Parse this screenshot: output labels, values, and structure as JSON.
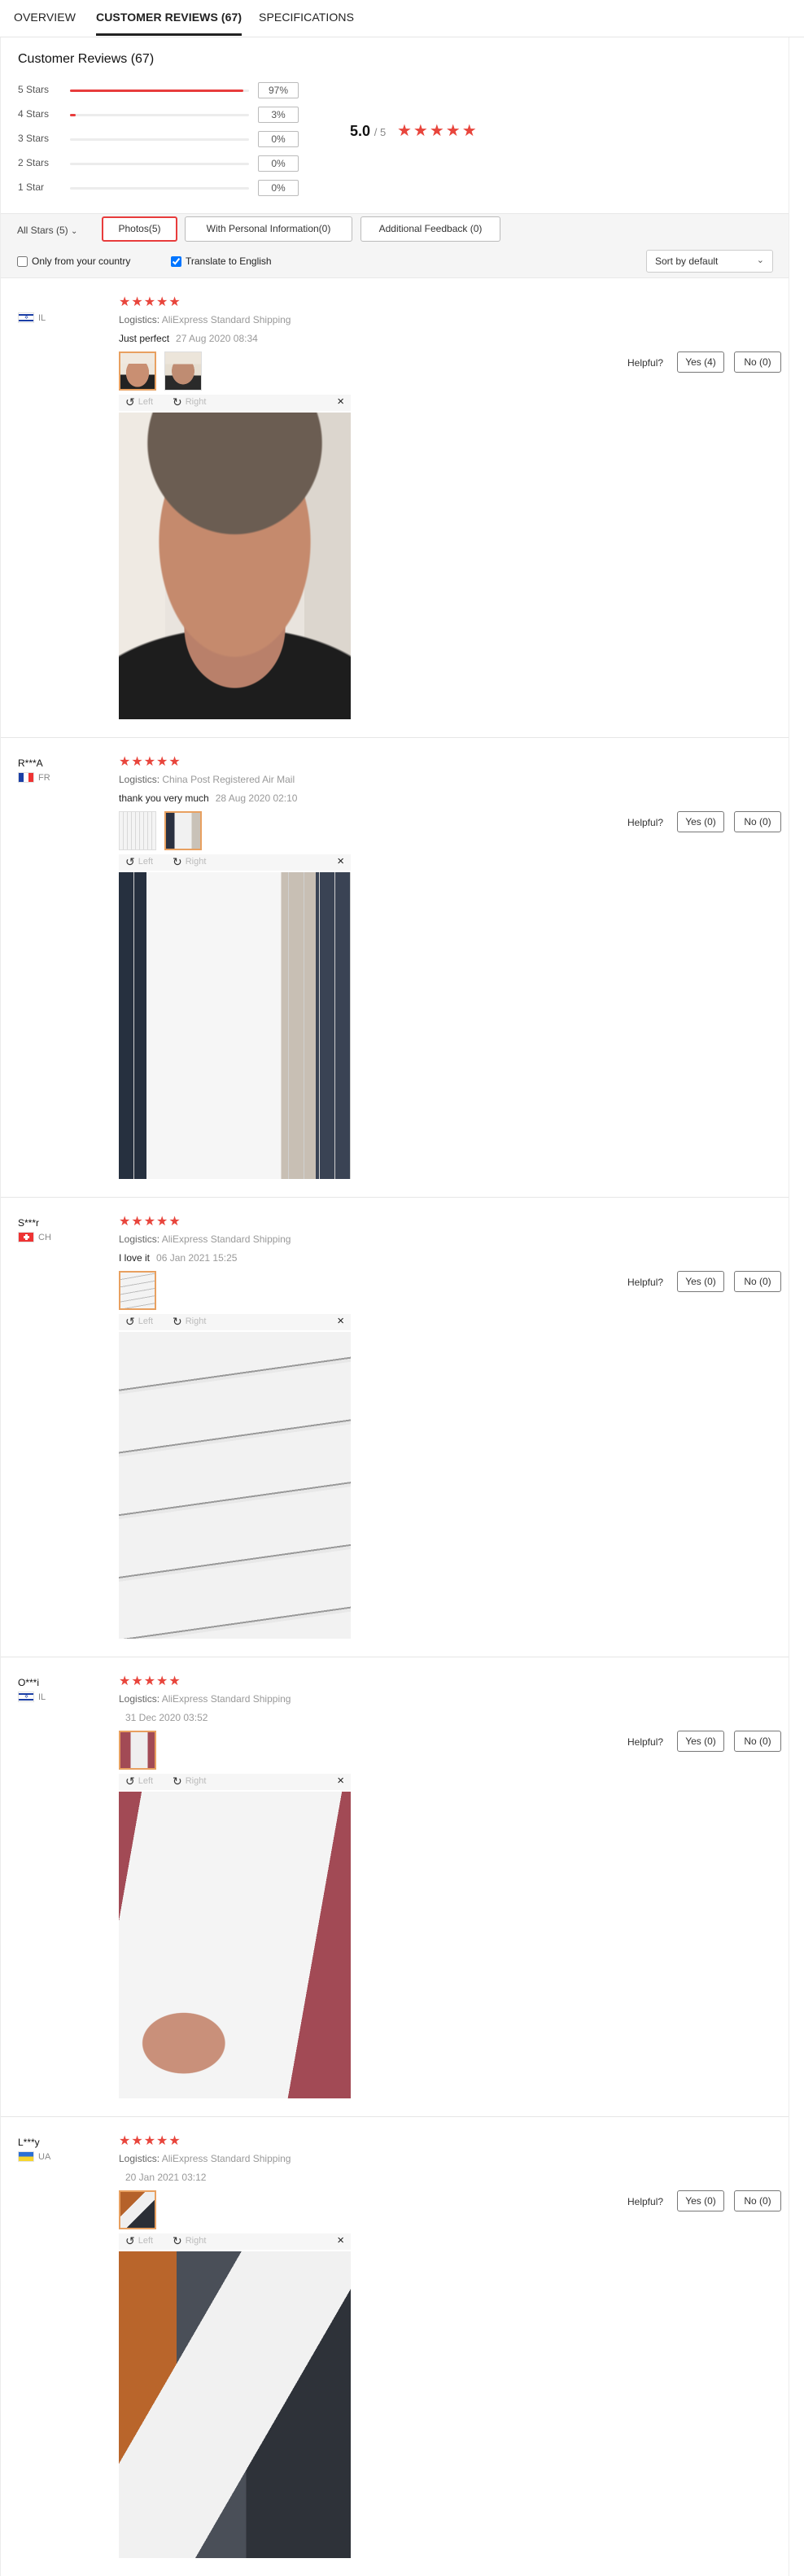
{
  "tabs": [
    {
      "label": "OVERVIEW"
    },
    {
      "label": "CUSTOMER REVIEWS (67)"
    },
    {
      "label": "SPECIFICATIONS"
    }
  ],
  "reviews_title": "Customer Reviews (67)",
  "rating_breakdown": [
    {
      "label": "5 Stars",
      "percent": "97%",
      "fill": 0.97
    },
    {
      "label": "4 Stars",
      "percent": "3%",
      "fill": 0.03
    },
    {
      "label": "3 Stars",
      "percent": "0%",
      "fill": 0
    },
    {
      "label": "2 Stars",
      "percent": "0%",
      "fill": 0
    },
    {
      "label": "1 Star",
      "percent": "0%",
      "fill": 0
    }
  ],
  "average": {
    "score": "5.0",
    "out_of": "/ 5",
    "stars": "★★★★★"
  },
  "filters": {
    "stars_dropdown": "All Stars (5)",
    "chips": [
      "Photos(5)",
      "With Personal Information(0)",
      "Additional Feedback (0)"
    ],
    "only_country": "Only from your country",
    "translate": "Translate to English",
    "sort": "Sort by default"
  },
  "labels": {
    "logistics": "Logistics:",
    "helpful": "Helpful?",
    "rotate_left": "Left",
    "rotate_right": "Right",
    "close": "×"
  },
  "colors": {
    "accent": "#e8453c",
    "thumb_border": "#e8a060"
  },
  "reviews": [
    {
      "user": "",
      "country": "IL",
      "stars": "★★★★★",
      "logistics": "AliExpress Standard Shipping",
      "text": "Just perfect",
      "date": "27 Aug 2020 08:34",
      "yes": "Yes (4)",
      "no": "No (0)"
    },
    {
      "user": "R***A",
      "country": "FR",
      "stars": "★★★★★",
      "logistics": "China Post Registered Air Mail",
      "text": "thank you very much",
      "date": "28 Aug 2020 02:10",
      "yes": "Yes (0)",
      "no": "No (0)"
    },
    {
      "user": "S***r",
      "country": "CH",
      "stars": "★★★★★",
      "logistics": "AliExpress Standard Shipping",
      "text": "I love it",
      "date": "06 Jan 2021 15:25",
      "yes": "Yes (0)",
      "no": "No (0)"
    },
    {
      "user": "O***i",
      "country": "IL",
      "stars": "★★★★★",
      "logistics": "AliExpress Standard Shipping",
      "text": "",
      "date": "31 Dec 2020 03:52",
      "yes": "Yes (0)",
      "no": "No (0)"
    },
    {
      "user": "L***y",
      "country": "UA",
      "stars": "★★★★★",
      "logistics": "AliExpress Standard Shipping",
      "text": "",
      "date": "20 Jan 2021 03:12",
      "yes": "Yes (0)",
      "no": "No (0)"
    }
  ]
}
